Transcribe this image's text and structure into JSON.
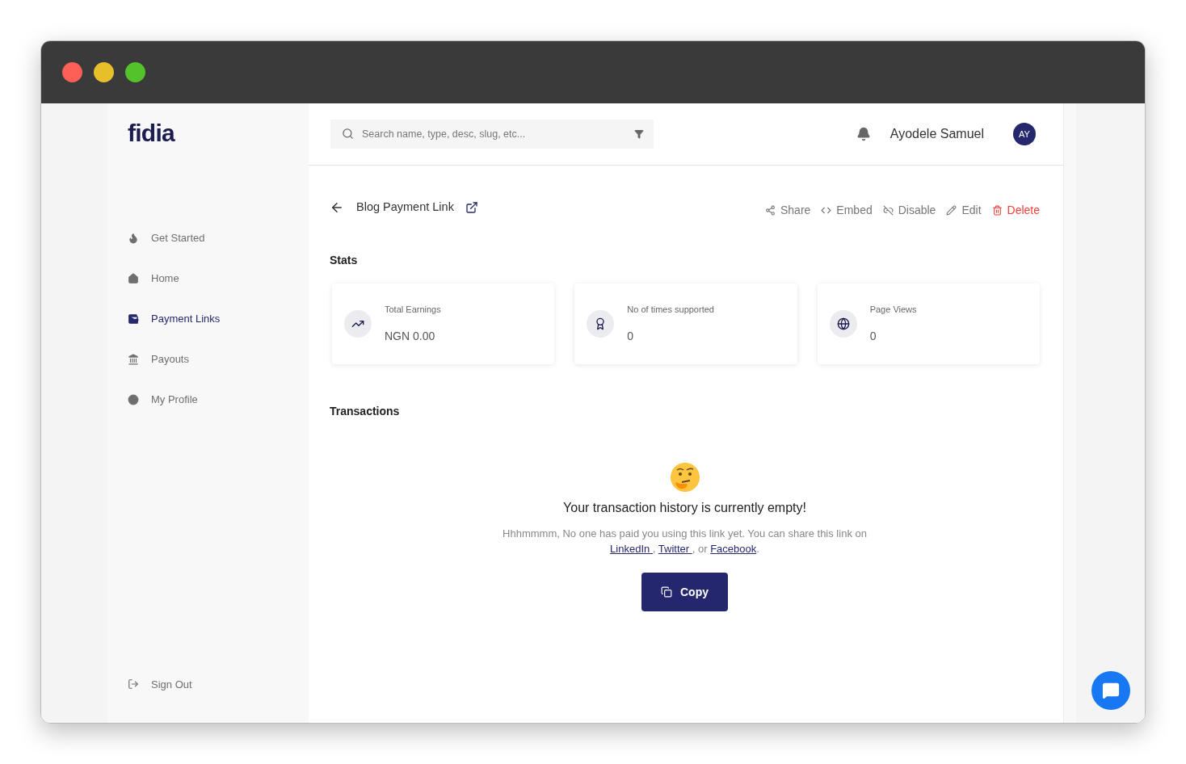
{
  "sidebar": {
    "logo": "fidia",
    "items": [
      {
        "label": "Get Started",
        "selected": false
      },
      {
        "label": "Home",
        "selected": false
      },
      {
        "label": "Payment Links",
        "selected": true
      },
      {
        "label": "Payouts",
        "selected": false
      },
      {
        "label": "My Profile",
        "selected": false
      }
    ],
    "sign_out": "Sign Out"
  },
  "topbar": {
    "search": {
      "placeholder": "Search name, type, desc, slug, etc..."
    },
    "user_name": "Ayodele Samuel",
    "avatar": "AY"
  },
  "header": {
    "title": "Blog Payment Link",
    "actions": [
      {
        "label": "Share",
        "kind": "normal"
      },
      {
        "label": "Embed",
        "kind": "normal"
      },
      {
        "label": "Disable",
        "kind": "normal"
      },
      {
        "label": "Edit",
        "kind": "normal"
      },
      {
        "label": "Delete",
        "kind": "danger"
      }
    ]
  },
  "stats": {
    "heading": "Stats",
    "cards": [
      {
        "label": "Total Earnings",
        "value": "NGN 0.00"
      },
      {
        "label": "No of times supported",
        "value": "0"
      },
      {
        "label": "Page Views",
        "value": "0"
      }
    ]
  },
  "transactions": {
    "heading": "Transactions",
    "empty_title": "Your transaction history is currently empty!",
    "message": [
      {
        "kind": "text",
        "text": "Hhhmmmm, No one has paid you using this link yet. You can share this link on "
      },
      {
        "kind": "link",
        "text": "LinkedIn "
      },
      {
        "kind": "text",
        "text": ", "
      },
      {
        "kind": "link",
        "text": "Twitter "
      },
      {
        "kind": "text",
        "text": ", or "
      },
      {
        "kind": "link",
        "text": "Facebook"
      },
      {
        "kind": "text",
        "text": "."
      }
    ],
    "button": "Copy"
  }
}
